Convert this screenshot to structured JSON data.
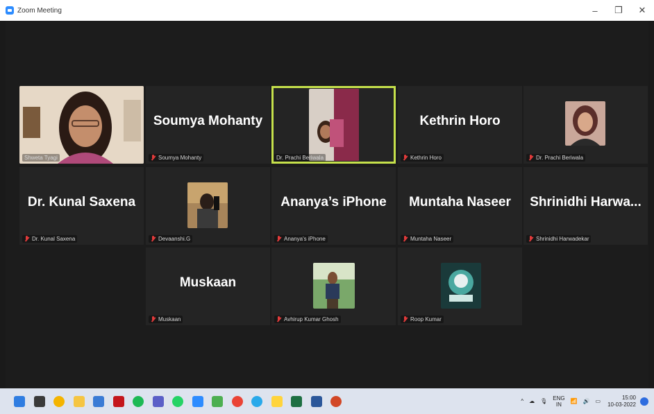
{
  "window": {
    "title": "Zoom Meeting",
    "minimize": "–",
    "restore": "❐",
    "close": "✕"
  },
  "participants": [
    {
      "display_name": "",
      "caption": "Shweta Tyagi",
      "video": true,
      "muted": false
    },
    {
      "display_name": "Soumya Mohanty",
      "caption": "Soumya Mohanty",
      "video": false,
      "muted": true
    },
    {
      "display_name": "",
      "caption": "Dr. Prachi Beriwala",
      "video": true,
      "muted": false,
      "active_speaker": true
    },
    {
      "display_name": "Kethrin Horo",
      "caption": "Kethrin Horo",
      "video": false,
      "muted": true
    },
    {
      "display_name": "",
      "caption": "Dr. Prachi Beriwala",
      "video": false,
      "muted": true,
      "has_avatar": true
    },
    {
      "display_name": "Dr. Kunal Saxena",
      "caption": "Dr. Kunal Saxena",
      "video": false,
      "muted": true
    },
    {
      "display_name": "",
      "caption": "Devaanshi.G",
      "video": false,
      "muted": true,
      "has_avatar": true
    },
    {
      "display_name": "Ananya’s iPhone",
      "caption": "Ananya's iPhone",
      "video": false,
      "muted": true
    },
    {
      "display_name": "Muntaha Naseer",
      "caption": "Muntaha Naseer",
      "video": false,
      "muted": true
    },
    {
      "display_name": "Shrinidhi  Harwa...",
      "caption": "Shrinidhi Harwadekar",
      "video": false,
      "muted": true
    },
    {
      "display_name": "Muskaan",
      "caption": "Muskaan",
      "video": false,
      "muted": true
    },
    {
      "display_name": "",
      "caption": "Avhirup Kumar Ghosh",
      "video": false,
      "muted": true,
      "has_avatar": true
    },
    {
      "display_name": "",
      "caption": "Roop Kumar",
      "video": false,
      "muted": true,
      "has_avatar": true
    }
  ],
  "taskbar": {
    "apps": [
      "start-icon",
      "task-view-icon",
      "chrome-canary-icon",
      "file-explorer-icon",
      "office-icon",
      "netflix-icon",
      "spotify-icon",
      "teams-icon",
      "whatsapp-icon",
      "zoom-icon",
      "app-icon",
      "chrome-icon",
      "telegram-icon",
      "sticky-notes-icon",
      "excel-icon",
      "word-icon",
      "powerpoint-icon"
    ],
    "tray": {
      "language": "ENG",
      "region": "IN",
      "time": "15:00",
      "date": "10-03-2022"
    }
  },
  "colors": {
    "active_border": "#c6e14b",
    "tile_bg": "#242424",
    "muted_icon": "#e23b3b"
  }
}
